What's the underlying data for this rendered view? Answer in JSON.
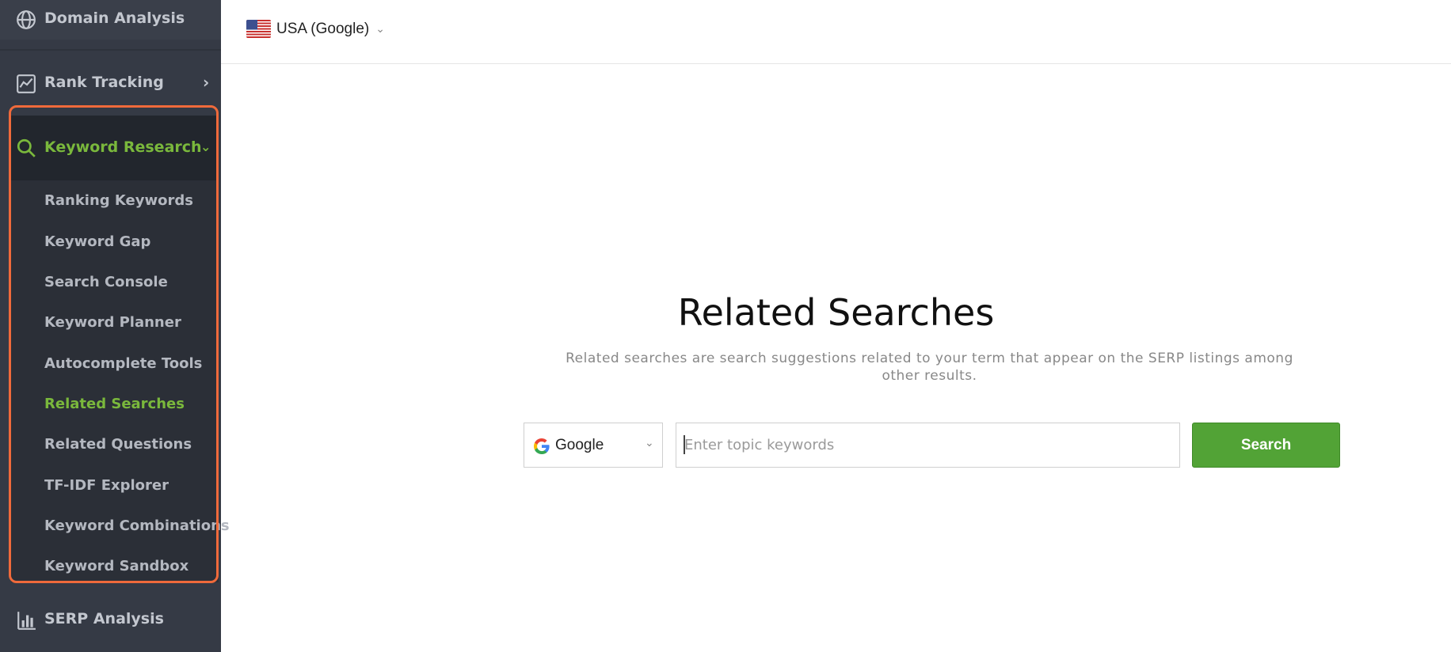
{
  "sidebar": {
    "domain_analysis": "Domain Analysis",
    "rank_tracking": "Rank Tracking",
    "keyword_research": "Keyword Research",
    "serp_analysis": "SERP Analysis",
    "keyword_items": [
      {
        "label": "Ranking Keywords",
        "active": false
      },
      {
        "label": "Keyword Gap",
        "active": false
      },
      {
        "label": "Search Console",
        "active": false
      },
      {
        "label": "Keyword Planner",
        "active": false
      },
      {
        "label": "Autocomplete Tools",
        "active": false
      },
      {
        "label": "Related Searches",
        "active": true
      },
      {
        "label": "Related Questions",
        "active": false
      },
      {
        "label": "TF-IDF Explorer",
        "active": false
      },
      {
        "label": "Keyword Combinations",
        "active": false
      },
      {
        "label": "Keyword Sandbox",
        "active": false
      }
    ]
  },
  "topbar": {
    "region": "USA (Google)"
  },
  "main": {
    "title": "Related Searches",
    "description": "Related searches are search suggestions related to your term that appear on the SERP listings among other results.",
    "engine": "Google",
    "input_placeholder": "Enter topic keywords",
    "search_button": "Search"
  },
  "colors": {
    "accent": "#7ab83c",
    "button": "#52a336",
    "highlight": "#f06a3b",
    "sidebar_bg": "#353a45"
  }
}
